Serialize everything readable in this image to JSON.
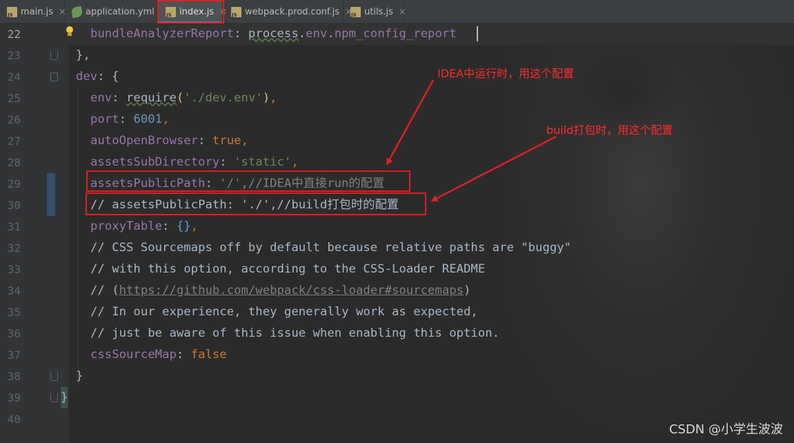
{
  "tabs": [
    {
      "label": "main.js",
      "icon": "js-file-icon",
      "active": false
    },
    {
      "label": "application.yml",
      "icon": "yaml-leaf-icon",
      "active": false
    },
    {
      "label": "index.js",
      "icon": "js-file-icon",
      "active": true
    },
    {
      "label": "webpack.prod.conf.js",
      "icon": "js-file-icon",
      "active": false
    },
    {
      "label": "utils.js",
      "icon": "js-file-icon",
      "active": false
    }
  ],
  "close_glyph": "×",
  "line_numbers": [
    "22",
    "23",
    "24",
    "25",
    "26",
    "27",
    "28",
    "29",
    "30",
    "31",
    "32",
    "33",
    "34",
    "35",
    "36",
    "37",
    "38",
    "39",
    "40"
  ],
  "code": {
    "l22": {
      "key": "bundleAnalyzerReport",
      "colon": ": ",
      "obj": "process",
      "dot1": ".",
      "env": "env",
      "dot2": ".",
      "prop": "npm_config_report"
    },
    "l23": {
      "text": "},"
    },
    "l24": {
      "key": "dev",
      "colon": ": ",
      "brace": "{"
    },
    "l25": {
      "key": "env",
      "colon": ": ",
      "fn": "require",
      "open": "(",
      "str": "'./dev.env'",
      "close": ")",
      "comma": ","
    },
    "l26": {
      "key": "port",
      "colon": ": ",
      "val": "6001",
      "comma": ","
    },
    "l27": {
      "key": "autoOpenBrowser",
      "colon": ": ",
      "val": "true",
      "comma": ","
    },
    "l28": {
      "key": "assetsSubDirectory",
      "colon": ": ",
      "str": "'static'",
      "comma": ","
    },
    "l29": {
      "key": "assetsPublicPath",
      "colon": ": ",
      "str": "'/'",
      "comma": ",",
      "comment": "//IDEA中直接run的配置"
    },
    "l30": {
      "comment": "// assetsPublicPath: './',//build打包时的配置"
    },
    "l31": {
      "key": "proxyTable",
      "colon": ": ",
      "val": "{}",
      "comma": ","
    },
    "l32": {
      "comment": "// CSS Sourcemaps off by default because relative paths are \"buggy\""
    },
    "l33": {
      "comment": "// with this option, according to the CSS-Loader README"
    },
    "l34": {
      "pre": "// (",
      "link": "https://github.com/webpack/css-loader#sourcemaps",
      "post": ")"
    },
    "l35": {
      "comment": "// In our experience, they generally work as expected,"
    },
    "l36": {
      "comment": "// just be aware of this issue when enabling this option."
    },
    "l37": {
      "key": "cssSourceMap",
      "colon": ": ",
      "val": "false"
    },
    "l38": {
      "text": "}"
    },
    "l39": {
      "text": "}"
    }
  },
  "annotations": {
    "idea_note": "IDEA中运行时，用这个配置",
    "build_note": "build打包时，用这个配置"
  },
  "watermark": "CSDN @小学生波波",
  "colors": {
    "annotation_red": "#e02020",
    "editor_bg": "#2b2b2b",
    "keyword": "#cc7832",
    "property": "#9876aa",
    "string": "#6a8759",
    "comment": "#808080"
  }
}
